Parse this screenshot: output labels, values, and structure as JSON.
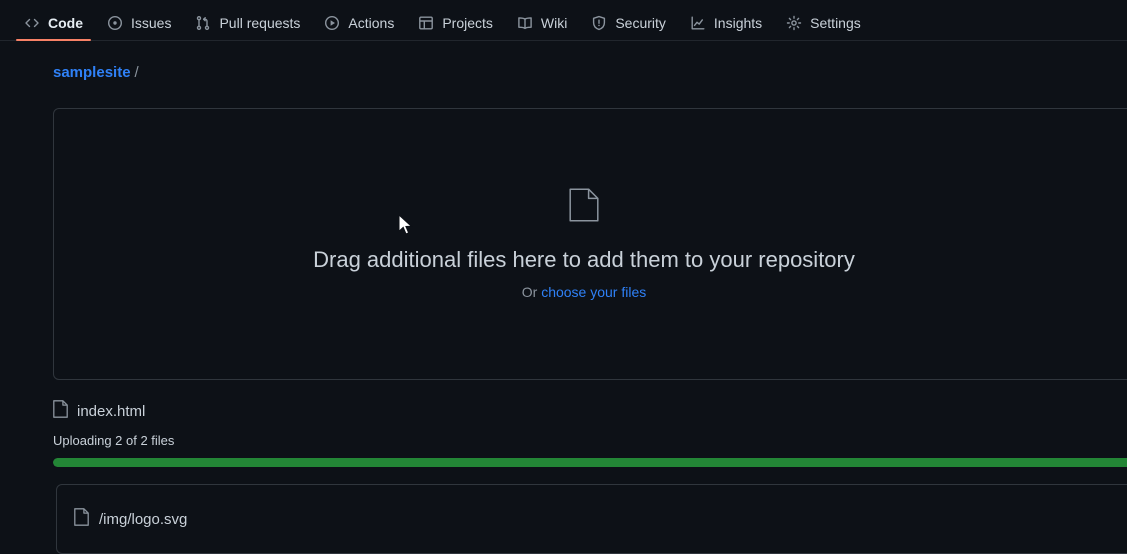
{
  "nav": {
    "tabs": [
      {
        "label": "Code",
        "icon": "code-icon",
        "active": true
      },
      {
        "label": "Issues",
        "icon": "issue-opened-icon",
        "active": false
      },
      {
        "label": "Pull requests",
        "icon": "git-pull-request-icon",
        "active": false
      },
      {
        "label": "Actions",
        "icon": "play-icon",
        "active": false
      },
      {
        "label": "Projects",
        "icon": "table-icon",
        "active": false
      },
      {
        "label": "Wiki",
        "icon": "book-icon",
        "active": false
      },
      {
        "label": "Security",
        "icon": "shield-icon",
        "active": false
      },
      {
        "label": "Insights",
        "icon": "graph-icon",
        "active": false
      },
      {
        "label": "Settings",
        "icon": "gear-icon",
        "active": false
      }
    ]
  },
  "breadcrumb": {
    "repo": "samplesite",
    "separator": "/"
  },
  "dropzone": {
    "icon": "file-icon",
    "title": "Drag additional files here to add them to your repository",
    "or_text": "Or",
    "choose_link": "choose your files"
  },
  "upload": {
    "file_icon": "file-icon",
    "file_name": "index.html",
    "status_text": "Uploading 2 of 2 files",
    "progress_percent": 100
  },
  "queued_file": {
    "file_icon": "file-icon",
    "path": "/img/logo.svg"
  },
  "colors": {
    "background": "#0d1117",
    "border": "#30363d",
    "text": "#c9d1d9",
    "muted": "#8b949e",
    "link": "#2f81f7",
    "accent_underline": "#f78166",
    "progress_green": "#238636"
  }
}
